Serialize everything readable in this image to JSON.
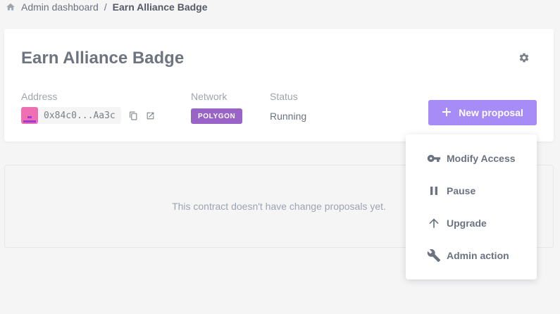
{
  "breadcrumb": {
    "parent": "Admin dashboard",
    "separator": "/",
    "current": "Earn Alliance Badge"
  },
  "contract": {
    "title": "Earn Alliance Badge",
    "address_label": "Address",
    "address_value": "0x84c0...Aa3c",
    "network_label": "Network",
    "network_value": "POLYGON",
    "status_label": "Status",
    "status_value": "Running"
  },
  "actions": {
    "new_proposal_label": "New proposal"
  },
  "empty_state": {
    "message": "This contract doesn't have change proposals yet."
  },
  "menu": {
    "items": [
      {
        "label": "Modify Access",
        "icon": "key-icon"
      },
      {
        "label": "Pause",
        "icon": "pause-icon"
      },
      {
        "label": "Upgrade",
        "icon": "arrow-up-icon"
      },
      {
        "label": "Admin action",
        "icon": "wrench-icon"
      }
    ]
  },
  "colors": {
    "primary": "#a78bf7",
    "network_badge": "#9a63c7",
    "text_muted": "#6b7280",
    "identicon_pink": "#ee6fb2"
  }
}
